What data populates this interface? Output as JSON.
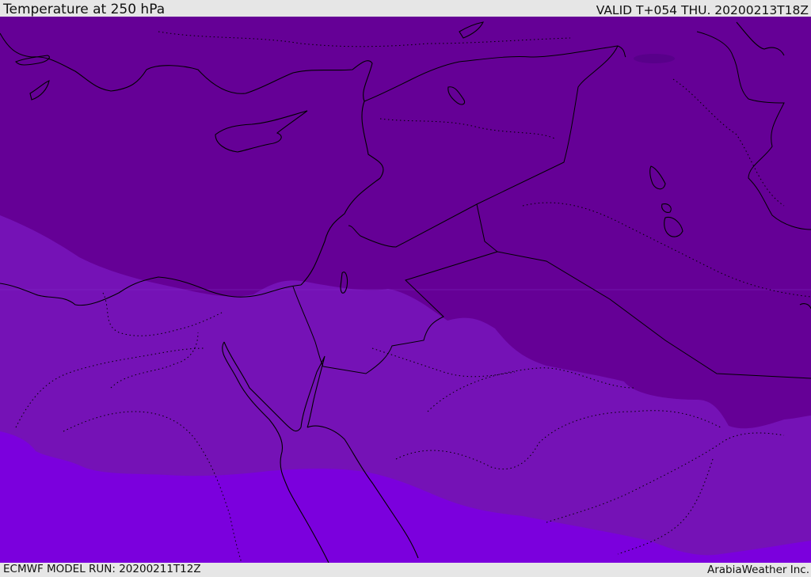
{
  "header": {
    "title": "Temperature at 250 hPa",
    "valid_time": "VALID T+054 THU. 20200213T18Z"
  },
  "footer": {
    "model_run": "ECMWF MODEL RUN: 20200211T12Z",
    "credit": "ArabiaWeather Inc."
  },
  "map": {
    "field": "temperature-250hPa",
    "colors": {
      "coldest_band": "#650096",
      "middle_band": "#7512b6",
      "warmest_band": "#7b00dd",
      "small_cold_pocket": "#58008a",
      "coastline": "#000000",
      "borders": "#000000"
    }
  }
}
